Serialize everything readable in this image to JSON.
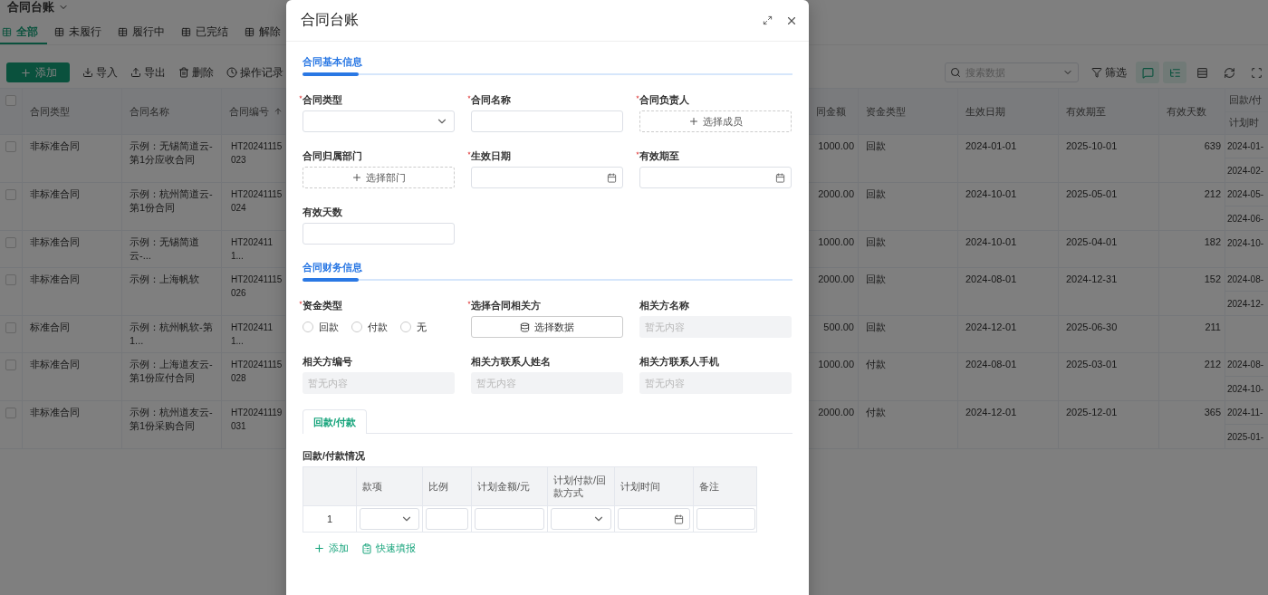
{
  "page": {
    "title": "合同台账",
    "tabs": [
      {
        "label": "全部",
        "selected": true
      },
      {
        "label": "未履行",
        "selected": false
      },
      {
        "label": "履行中",
        "selected": false
      },
      {
        "label": "已完结",
        "selected": false
      },
      {
        "label": "解除",
        "selected": false
      }
    ],
    "actions": [
      {
        "label": "添加",
        "kind": "add"
      },
      {
        "label": "导入",
        "kind": "import"
      },
      {
        "label": "导出",
        "kind": "export"
      },
      {
        "label": "删除",
        "kind": "delete"
      },
      {
        "label": "操作记录",
        "kind": "log"
      }
    ],
    "search": {
      "placeholder": "搜索数据"
    },
    "filter": {
      "label": "筛选"
    },
    "tools": [
      {
        "kind": "comment",
        "active": true
      },
      {
        "kind": "tree",
        "active": true
      },
      {
        "kind": "rows",
        "active": false
      },
      {
        "kind": "refresh",
        "active": false
      },
      {
        "kind": "fullscreen",
        "active": false
      }
    ]
  },
  "table": {
    "all_checked": false,
    "columns": [
      {
        "label": "合同类型",
        "sorted": false
      },
      {
        "label": "合同名称",
        "sorted": false
      },
      {
        "label": "合同编号",
        "sorted": true
      },
      {
        "label": "同金额",
        "sorted": false
      },
      {
        "label": "资金类型",
        "sorted": false
      },
      {
        "label": "生效日期",
        "sorted": false
      },
      {
        "label": "有效期至",
        "sorted": false
      },
      {
        "label": "有效天数",
        "sorted": false
      }
    ],
    "group_column": {
      "label": "回款/付",
      "sub_label": "计划时"
    },
    "rows": [
      {
        "checked": false,
        "type": "非标准合同",
        "name": "示例：无锡简道云-第1分应收合同",
        "number": "HT20241115023",
        "amount": "1000.00",
        "fund": "回款",
        "start": "2024-01-01",
        "end": "2025-10-01",
        "days": "639",
        "plans": [
          "2024-01-",
          "2024-02-"
        ]
      },
      {
        "checked": false,
        "type": "非标准合同",
        "name": "示例：杭州简道云-第1份合同",
        "number": "HT20241115024",
        "amount": "2000.00",
        "fund": "回款",
        "start": "2024-10-01",
        "end": "2025-05-01",
        "days": "212",
        "plans": [
          "2024-05-",
          "2024-06-"
        ]
      },
      {
        "checked": false,
        "type": "非标准合同",
        "name": "示例：无锡简道云-...",
        "number": "HT2024111...",
        "amount": "1000.00",
        "fund": "回款",
        "start": "2024-10-01",
        "end": "2025-04-01",
        "days": "182",
        "plans": [
          "2024-10-"
        ]
      },
      {
        "checked": false,
        "type": "非标准合同",
        "name": "示例：上海帆软",
        "number": "HT20241115026",
        "amount": "2000.00",
        "fund": "回款",
        "start": "2024-08-01",
        "end": "2024-12-31",
        "days": "152",
        "plans": [
          "2024-08-",
          "2024-12-"
        ]
      },
      {
        "checked": false,
        "type": "标准合同",
        "name": "示例：杭州帆软-第1...",
        "number": "HT2024111...",
        "amount": "500.00",
        "fund": "回款",
        "start": "2024-12-01",
        "end": "2025-06-30",
        "days": "211",
        "plans": []
      },
      {
        "checked": false,
        "type": "非标准合同",
        "name": "示例：上海道友云-第1份应付合同",
        "number": "HT20241115028",
        "amount": "1000.00",
        "fund": "付款",
        "start": "2024-08-01",
        "end": "2025-03-01",
        "days": "212",
        "plans": [
          "2024-08-",
          "2024-10-"
        ]
      },
      {
        "checked": false,
        "type": "非标准合同",
        "name": "示例：杭州道友云-第1份采购合同",
        "number": "HT20241119031",
        "amount": "2000.00",
        "fund": "付款",
        "start": "2024-12-01",
        "end": "2025-12-01",
        "days": "365",
        "plans": [
          "2024-11-",
          "2025-01-"
        ]
      }
    ]
  },
  "modal": {
    "title": "合同台账",
    "sections": [
      {
        "title": "合同基本信息",
        "fields": [
          {
            "label": "合同类型",
            "required": true,
            "kind": "select"
          },
          {
            "label": "合同名称",
            "required": true,
            "kind": "text"
          },
          {
            "label": "合同负责人",
            "required": true,
            "kind": "picker",
            "button": "选择成员"
          },
          {
            "label": "合同归属部门",
            "required": false,
            "kind": "picker",
            "button": "选择部门"
          },
          {
            "label": "生效日期",
            "required": true,
            "kind": "date"
          },
          {
            "label": "有效期至",
            "required": true,
            "kind": "date"
          },
          {
            "label": "有效天数",
            "required": false,
            "kind": "text"
          }
        ]
      },
      {
        "title": "合同财务信息",
        "fields": [
          {
            "label": "资金类型",
            "required": true,
            "kind": "radio",
            "options": [
              {
                "label": "回款",
                "selected": false
              },
              {
                "label": "付款",
                "selected": false
              },
              {
                "label": "无",
                "selected": false
              }
            ]
          },
          {
            "label": "选择合同相关方",
            "required": true,
            "kind": "data",
            "button": "选择数据"
          },
          {
            "label": "相关方名称",
            "required": false,
            "kind": "readonly",
            "placeholder": "暂无内容"
          },
          {
            "label": "相关方编号",
            "required": false,
            "kind": "readonly",
            "placeholder": "暂无内容"
          },
          {
            "label": "相关方联系人姓名",
            "required": false,
            "kind": "readonly",
            "placeholder": "暂无内容"
          },
          {
            "label": "相关方联系人手机",
            "required": false,
            "kind": "readonly",
            "placeholder": "暂无内容"
          }
        ]
      }
    ],
    "subtabs": [
      {
        "label": "回款/付款",
        "selected": true
      }
    ],
    "subtable": {
      "title": "回款/付款情况",
      "columns": [
        {
          "label": "款项",
          "kind": "select"
        },
        {
          "label": "比例",
          "kind": "text"
        },
        {
          "label": "计划金额/元",
          "kind": "text"
        },
        {
          "label": "计划付款/回款方式",
          "kind": "select"
        },
        {
          "label": "计划时间",
          "kind": "date"
        },
        {
          "label": "备注",
          "kind": "text"
        }
      ],
      "rows": [
        {
          "index": "1"
        }
      ]
    },
    "row_actions": [
      {
        "label": "添加",
        "kind": "add"
      },
      {
        "label": "快速填报",
        "kind": "quick"
      }
    ]
  }
}
